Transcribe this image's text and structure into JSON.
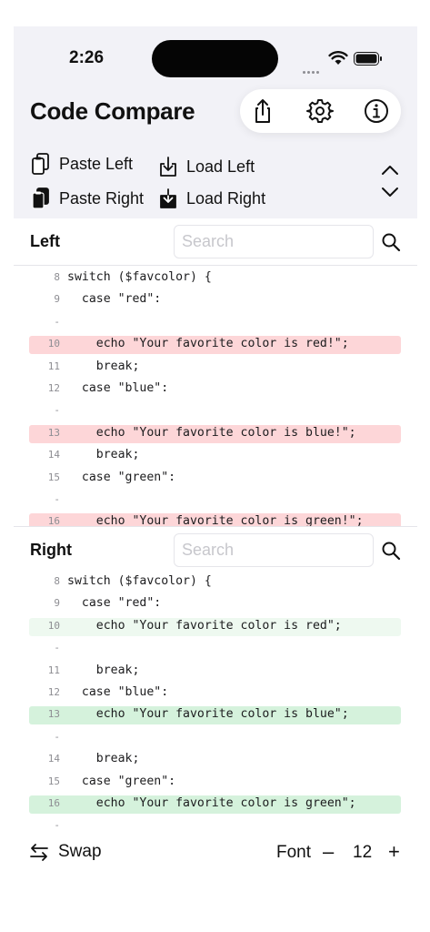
{
  "status": {
    "time": "2:26"
  },
  "app": {
    "title": "Code Compare"
  },
  "toolbar": {
    "icons": [
      "share-icon",
      "gear-icon",
      "info-icon"
    ]
  },
  "actions": {
    "paste_left": "Paste Left",
    "load_left": "Load Left",
    "paste_right": "Paste Right",
    "load_right": "Load Right"
  },
  "left": {
    "label": "Left",
    "search_placeholder": "Search",
    "lines": [
      {
        "num": "8",
        "text": "switch ($favcolor) {",
        "kind": "normal"
      },
      {
        "num": "9",
        "text": "  case \"red\":",
        "kind": "normal"
      },
      {
        "num": "-",
        "text": "",
        "kind": "gap"
      },
      {
        "num": "10",
        "text": "    echo \"Your favorite color is red!\";",
        "kind": "removed"
      },
      {
        "num": "11",
        "text": "    break;",
        "kind": "normal"
      },
      {
        "num": "12",
        "text": "  case \"blue\":",
        "kind": "normal"
      },
      {
        "num": "-",
        "text": "",
        "kind": "gap"
      },
      {
        "num": "13",
        "text": "    echo \"Your favorite color is blue!\";",
        "kind": "removed"
      },
      {
        "num": "14",
        "text": "    break;",
        "kind": "normal"
      },
      {
        "num": "15",
        "text": "  case \"green\":",
        "kind": "normal"
      },
      {
        "num": "-",
        "text": "",
        "kind": "gap"
      },
      {
        "num": "16",
        "text": "    echo \"Your favorite color is green!\";",
        "kind": "removed"
      }
    ]
  },
  "right": {
    "label": "Right",
    "search_placeholder": "Search",
    "lines": [
      {
        "num": "8",
        "text": "switch ($favcolor) {",
        "kind": "normal"
      },
      {
        "num": "9",
        "text": "  case \"red\":",
        "kind": "normal"
      },
      {
        "num": "10",
        "text": "    echo \"Your favorite color is red\";",
        "kind": "changed"
      },
      {
        "num": "-",
        "text": "",
        "kind": "gap"
      },
      {
        "num": "11",
        "text": "    break;",
        "kind": "normal"
      },
      {
        "num": "12",
        "text": "  case \"blue\":",
        "kind": "normal"
      },
      {
        "num": "13",
        "text": "    echo \"Your favorite color is blue\";",
        "kind": "added"
      },
      {
        "num": "-",
        "text": "",
        "kind": "gap"
      },
      {
        "num": "14",
        "text": "    break;",
        "kind": "normal"
      },
      {
        "num": "15",
        "text": "  case \"green\":",
        "kind": "normal"
      },
      {
        "num": "16",
        "text": "    echo \"Your favorite color is green\";",
        "kind": "added"
      },
      {
        "num": "-",
        "text": "",
        "kind": "gap"
      }
    ]
  },
  "bottom": {
    "swap": "Swap",
    "font_label": "Font",
    "font_minus": "–",
    "font_size": "12",
    "font_plus": "+"
  },
  "colors": {
    "removed": "#fdd6d8",
    "added": "#d5f2dc",
    "changed": "#eef9f0",
    "panel_bg": "#f2f2f7"
  }
}
